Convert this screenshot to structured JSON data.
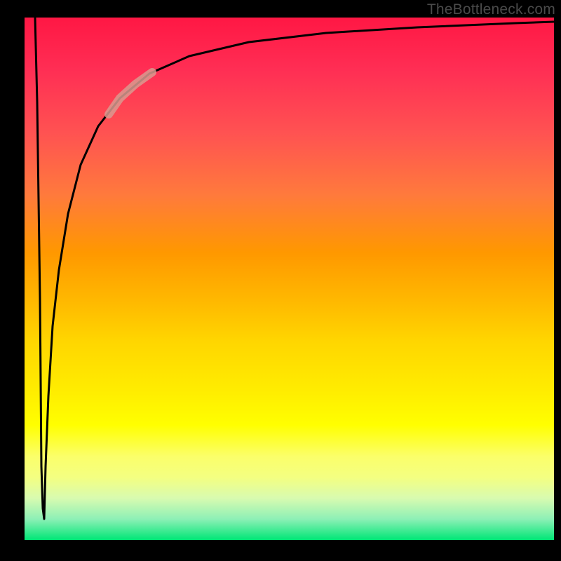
{
  "watermark": "TheBottleneck.com",
  "chart_data": {
    "type": "line",
    "title": "",
    "xlabel": "",
    "ylabel": "",
    "x_range": [
      0,
      100
    ],
    "y_range": [
      0,
      100
    ],
    "grid": false,
    "legend": false,
    "background_gradient": {
      "direction": "vertical",
      "stops": [
        {
          "pct": 0,
          "color": "#FF1744"
        },
        {
          "pct": 22,
          "color": "#FF5252"
        },
        {
          "pct": 45,
          "color": "#FF9800"
        },
        {
          "pct": 62,
          "color": "#FFD600"
        },
        {
          "pct": 78,
          "color": "#FFFF00"
        },
        {
          "pct": 86,
          "color": "#F4FF81"
        },
        {
          "pct": 94,
          "color": "#B9F6CA"
        },
        {
          "pct": 100,
          "color": "#00E676"
        }
      ]
    },
    "series": [
      {
        "name": "bottleneck-curve",
        "color": "#000000",
        "points": [
          {
            "x": 2.0,
            "y": 100
          },
          {
            "x": 3.2,
            "y": 4
          },
          {
            "x": 4.0,
            "y": 20
          },
          {
            "x": 5.0,
            "y": 36
          },
          {
            "x": 6.5,
            "y": 52
          },
          {
            "x": 8.5,
            "y": 64
          },
          {
            "x": 11.0,
            "y": 73
          },
          {
            "x": 14.0,
            "y": 80
          },
          {
            "x": 18.0,
            "y": 85
          },
          {
            "x": 24.0,
            "y": 89.5
          },
          {
            "x": 32.0,
            "y": 92.5
          },
          {
            "x": 44.0,
            "y": 95
          },
          {
            "x": 60.0,
            "y": 96.5
          },
          {
            "x": 80.0,
            "y": 97.5
          },
          {
            "x": 100.0,
            "y": 98
          }
        ]
      },
      {
        "name": "highlight-segment",
        "color": "#D99A8F",
        "points": [
          {
            "x": 14.0,
            "y": 80
          },
          {
            "x": 18.0,
            "y": 85
          },
          {
            "x": 22.0,
            "y": 88
          }
        ]
      }
    ],
    "annotations": []
  }
}
